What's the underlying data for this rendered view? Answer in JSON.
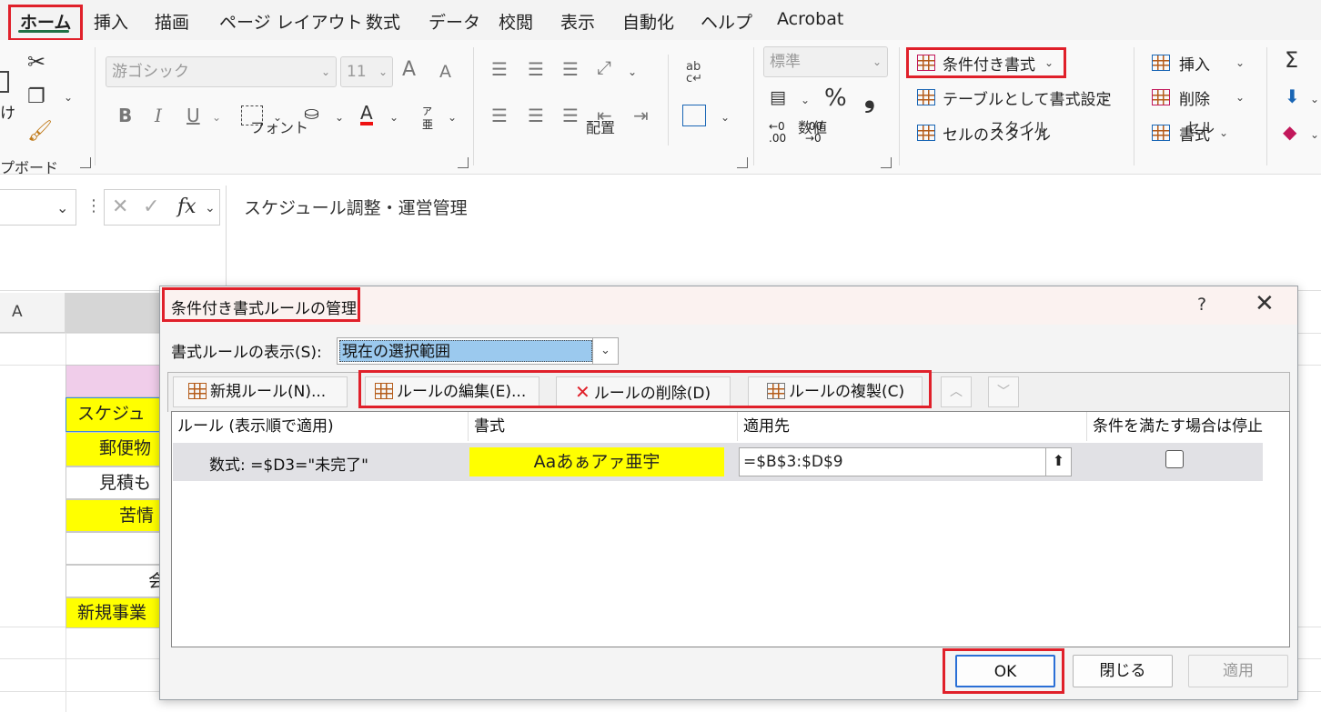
{
  "menu": {
    "tabs": [
      "ホーム",
      "挿入",
      "描画",
      "ページ レイアウト",
      "数式",
      "データ",
      "校閲",
      "表示",
      "自動化",
      "ヘルプ",
      "Acrobat"
    ]
  },
  "ribbon": {
    "clipboard": {
      "label": "プボード",
      "paste_partial": "け"
    },
    "font": {
      "label": "フォント",
      "font_name": "游ゴシック",
      "font_size": "11",
      "grow": "A",
      "shrink": "A",
      "bold": "B",
      "italic": "I",
      "underline": "U",
      "font_color": "A",
      "phonetic_top": "ア",
      "phonetic_bottom": "亜"
    },
    "alignment": {
      "label": "配置"
    },
    "number": {
      "label": "数値",
      "format": "標準",
      "percent": "%",
      "comma": "❟",
      "inc_decimal_top": "←0",
      "inc_decimal_bottom": ".00",
      "dec_decimal_top": ".00",
      "dec_decimal_bottom": "→0"
    },
    "styles": {
      "label": "スタイル",
      "conditional_formatting": "条件付き書式",
      "format_as_table": "テーブルとして書式設定",
      "cell_styles": "セルのスタイル"
    },
    "cells": {
      "label": "セル",
      "insert": "挿入",
      "delete": "削除",
      "format": "書式"
    },
    "editing": {
      "sum_icon": "Σ"
    }
  },
  "formula_bar": {
    "fx": "fx",
    "content": "スケジュール調整・運営管理"
  },
  "sheet": {
    "col_a": "A",
    "cells": [
      "スケジュ",
      "郵便物",
      "見積も",
      "苦情",
      "",
      "会",
      "新規事業"
    ]
  },
  "dialog": {
    "title": "条件付き書式ルールの管理",
    "help": "?",
    "close": "✕",
    "show_rules_label": "書式ルールの表示(S):",
    "show_rules_value": "現在の選択範囲",
    "buttons": {
      "new_rule": "新規ルール(N)...",
      "edit_rule": "ルールの編集(E)...",
      "delete_rule": "ルールの削除(D)",
      "duplicate_rule": "ルールの複製(C)",
      "move_up": "︿",
      "move_down": "﹀"
    },
    "columns": {
      "rule": "ルール (表示順で適用)",
      "format": "書式",
      "applies_to": "適用先",
      "stop_if_true": "条件を満たす場合は停止"
    },
    "rules": [
      {
        "condition": "数式: =$D3=\"未完了\"",
        "preview": "Aaあぁアァ亜宇",
        "applies_to": "=$B$3:$D$9",
        "stop_if_true": false
      }
    ],
    "ok": "OK",
    "close_button": "閉じる",
    "apply": "適用"
  },
  "colors": {
    "highlight_red": "#e0202a",
    "cell_yellow": "#ffff00",
    "header_pink": "#f0cdea",
    "selection_blue": "#9bc9ee"
  }
}
